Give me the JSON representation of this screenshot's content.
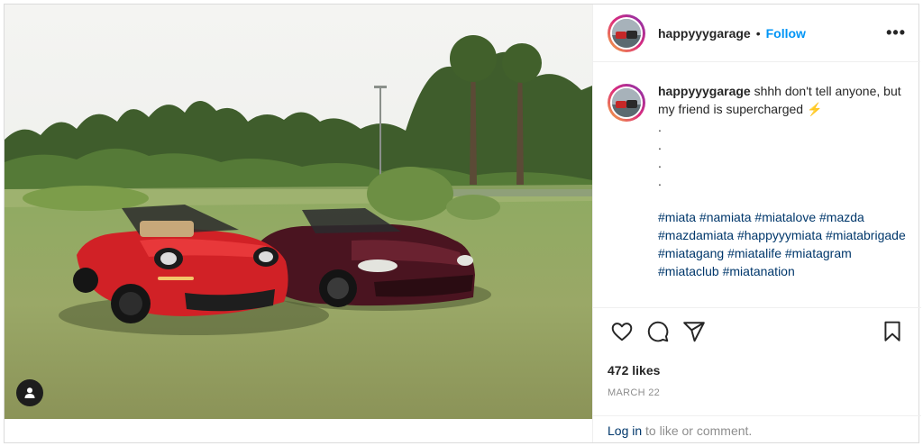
{
  "post": {
    "username": "happyyygarage",
    "separator": "•",
    "follow_label": "Follow",
    "more_label": "•••",
    "caption": {
      "username": "happyyygarage",
      "text": " shhh don't tell anyone, but my friend is supercharged ",
      "emoji": "⚡",
      "dots": [
        ".",
        ".",
        ".",
        "."
      ],
      "hashtags": [
        "#miata",
        "#namiata",
        "#miatalove",
        "#mazda",
        "#mazdamiata",
        "#happyyymiata",
        "#miatabrigade",
        "#miatagang",
        "#miatalife",
        "#miatagram",
        "#miataclub",
        "#miatanation"
      ]
    },
    "likes": "472 likes",
    "date": "MARCH 22",
    "login_link": "Log in",
    "login_text": " to like or comment.",
    "colors": {
      "follow": "#0095f6",
      "hashtag": "#00376b",
      "meta": "#8e8e8e"
    },
    "icons": [
      "heart-icon",
      "comment-icon",
      "share-icon",
      "bookmark-icon",
      "user-tag-icon",
      "more-icon"
    ]
  }
}
